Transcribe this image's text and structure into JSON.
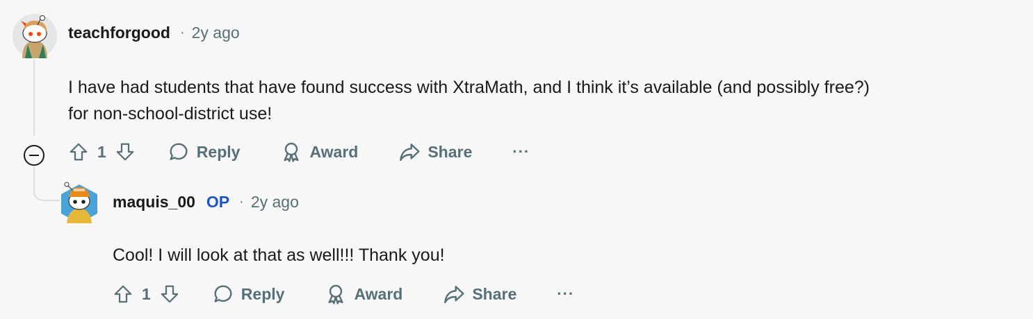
{
  "comments": [
    {
      "username": "teachforgood",
      "op_badge": "",
      "separator": "·",
      "time": "2y ago",
      "body_line1": "I have had students that have found success with XtraMath, and I think it’s available (and possibly free?)",
      "body_line2": "for non-school-district use!",
      "votes": "1",
      "reply_label": "Reply",
      "award_label": "Award",
      "share_label": "Share",
      "more_label": "···"
    },
    {
      "username": "maquis_00",
      "op_badge": "OP",
      "separator": "·",
      "time": "2y ago",
      "body_line1": "Cool! I will look at that as well!!! Thank you!",
      "votes": "1",
      "reply_label": "Reply",
      "award_label": "Award",
      "share_label": "Share",
      "more_label": "···"
    }
  ],
  "colors": {
    "background": "#f7f7f7",
    "text": "#1a1a1b",
    "muted": "#576f76",
    "op": "#1d55c7",
    "thread_line": "#dcdfe2"
  },
  "icons": [
    "upvote-icon",
    "downvote-icon",
    "reply-icon",
    "award-icon",
    "share-icon",
    "collapse-icon"
  ]
}
